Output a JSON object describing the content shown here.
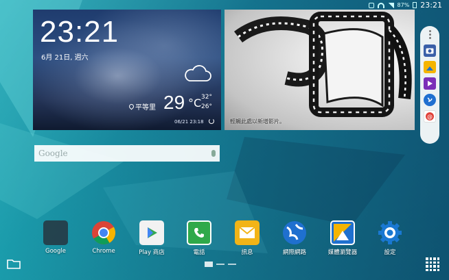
{
  "status_bar": {
    "battery_percent": "87%",
    "clock": "23:21"
  },
  "weather": {
    "time": "23:21",
    "date": "6月 21日, 週六",
    "location": "平等里",
    "temperature": "29",
    "unit": "°C",
    "high": "32°",
    "low": "26°",
    "updated": "06/21 23:18",
    "condition_icon": "cloud-icon"
  },
  "photo_widget": {
    "caption": "輕觸此處以新增影片。"
  },
  "side_panel": {
    "apps": [
      {
        "icon": "camera-icon",
        "color": "#3a5fa8"
      },
      {
        "icon": "gallery-icon",
        "color": "#f5b400"
      },
      {
        "icon": "video-icon",
        "color": "#7b2fb8"
      },
      {
        "icon": "internet-icon",
        "color": "#1f6fd0"
      },
      {
        "icon": "email-icon",
        "color": "#e04038"
      }
    ]
  },
  "search": {
    "placeholder": "Google"
  },
  "apps": [
    {
      "label": "Google",
      "icon": "google-folder-icon"
    },
    {
      "label": "Chrome",
      "icon": "chrome-icon"
    },
    {
      "label": "Play 商店",
      "icon": "play-store-icon"
    },
    {
      "label": "電話",
      "icon": "phone-icon"
    },
    {
      "label": "訊息",
      "icon": "messages-icon"
    },
    {
      "label": "網際網路",
      "icon": "internet-icon"
    },
    {
      "label": "媒體瀏覽器",
      "icon": "gallery-icon"
    },
    {
      "label": "設定",
      "icon": "settings-icon"
    }
  ],
  "colors": {
    "phone": "#2fa94a",
    "messages": "#f2b417",
    "internet": "#1f70cf",
    "settings": "#1a78d2"
  }
}
